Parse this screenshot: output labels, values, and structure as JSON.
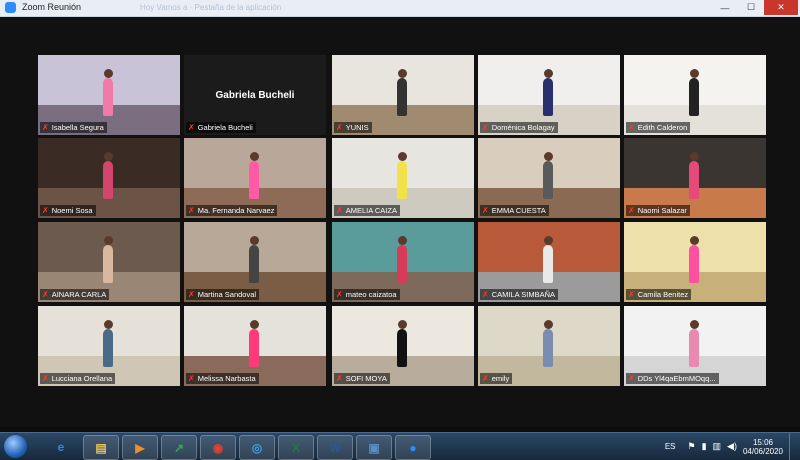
{
  "window": {
    "title": "Zoom Reunión",
    "background_tab_text": "Hoy Vamos a  ·  Pestaña de la aplicación",
    "min": "—",
    "max": "☐",
    "close": "✕"
  },
  "tiles": [
    {
      "name": "Isabella Segura",
      "wall": "#c9c3d8",
      "floor": "#7a6e80",
      "shirt": "#f07aa8"
    },
    {
      "name": "Gabriela Bucheli",
      "blank": true
    },
    {
      "name": "YUNIS",
      "wall": "#e8e5df",
      "floor": "#a08a70",
      "shirt": "#333333"
    },
    {
      "name": "Doménica Bolagay",
      "wall": "#f0efed",
      "floor": "#d8d2c6",
      "shirt": "#2a2f6e"
    },
    {
      "name": "Edith Calderon",
      "wall": "#f5f3f0",
      "floor": "#e4e1db",
      "shirt": "#222222",
      "active": true
    },
    {
      "name": "Noemi Sosa",
      "wall": "#3a2b24",
      "floor": "#6b5446",
      "shirt": "#d3456e"
    },
    {
      "name": "Ma. Fernanda Narvaez",
      "wall": "#b9a89a",
      "floor": "#8e6b56",
      "shirt": "#ff5aa3"
    },
    {
      "name": "AMELIA CAIZA",
      "wall": "#e7e5e0",
      "floor": "#cfcac0",
      "shirt": "#f2e24a"
    },
    {
      "name": "EMMA CUESTA",
      "wall": "#d9cdbe",
      "floor": "#8a6a52",
      "shirt": "#5a5a5a"
    },
    {
      "name": "Naomi Salazar",
      "wall": "#3a3531",
      "floor": "#c97a4a",
      "shirt": "#e64a7a"
    },
    {
      "name": "AINARA CARLA",
      "wall": "#6b5a4d",
      "floor": "#9a8675",
      "shirt": "#d8b9a0"
    },
    {
      "name": "Martina Sandoval",
      "wall": "#b8a898",
      "floor": "#7b5d45",
      "shirt": "#444444"
    },
    {
      "name": "mateo caizatoa",
      "wall": "#5a9c9c",
      "floor": "#7d6a5a",
      "shirt": "#d83a5a"
    },
    {
      "name": "CAMILA SIMBAÑA",
      "wall": "#b85a3a",
      "floor": "#9b9b9b",
      "shirt": "#e9e9e9"
    },
    {
      "name": "Camila Benitez",
      "wall": "#eee0ab",
      "floor": "#c8b07a",
      "shirt": "#ff4fa0"
    },
    {
      "name": "Lucciana Orellana",
      "wall": "#e6e1d8",
      "floor": "#d0c6b6",
      "shirt": "#4a6a8a"
    },
    {
      "name": "Melissa Narbasta",
      "wall": "#e5e2dc",
      "floor": "#8a6a5a",
      "shirt": "#ff3a7a"
    },
    {
      "name": "SOFI MOYA",
      "wall": "#ece7df",
      "floor": "#b8ad9d",
      "shirt": "#111111"
    },
    {
      "name": "emily",
      "wall": "#ddd8c7",
      "floor": "#c2b89e",
      "shirt": "#7a8db0"
    },
    {
      "name": "DDs Yl4qaEbmMOqq...",
      "wall": "#f2f2f2",
      "floor": "#d5d5d5",
      "shirt": "#e88ab0"
    }
  ],
  "taskbar": {
    "apps": [
      {
        "id": "ie",
        "glyph": "e",
        "color": "#2b8ae0"
      },
      {
        "id": "explorer",
        "glyph": "▤",
        "color": "#e6c15a"
      },
      {
        "id": "media",
        "glyph": "▶",
        "color": "#e8902a"
      },
      {
        "id": "stocks",
        "glyph": "↗",
        "color": "#2fae4e"
      },
      {
        "id": "chrome",
        "glyph": "◉",
        "color": "#dd4433"
      },
      {
        "id": "network",
        "glyph": "◎",
        "color": "#3aa0e0"
      },
      {
        "id": "excel",
        "glyph": "X",
        "color": "#1f7a3a"
      },
      {
        "id": "word",
        "glyph": "W",
        "color": "#2b579a"
      },
      {
        "id": "window",
        "glyph": "▣",
        "color": "#5a8ec8"
      },
      {
        "id": "zoom",
        "glyph": "●",
        "color": "#2d8cff"
      }
    ],
    "lang": "ES",
    "time": "15:06",
    "date": "04/06/2020"
  }
}
